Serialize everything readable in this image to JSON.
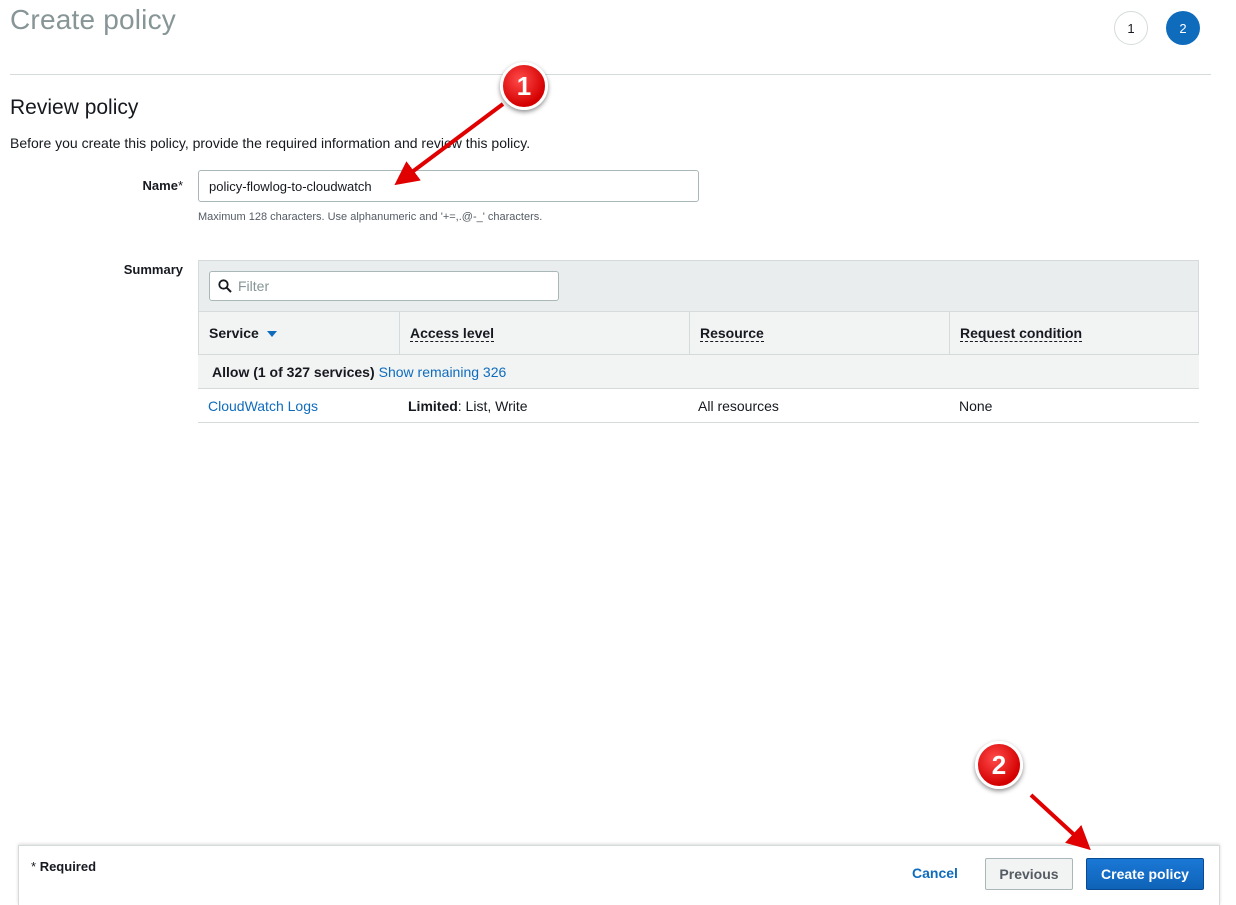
{
  "page": {
    "title": "Create policy",
    "steps": [
      "1",
      "2"
    ],
    "active_step": "2"
  },
  "review": {
    "title": "Review policy",
    "description": "Before you create this policy, provide the required information and review this policy."
  },
  "name_field": {
    "label": "Name",
    "required_mark": "*",
    "value": "policy-flowlog-to-cloudwatch",
    "hint": "Maximum 128 characters. Use alphanumeric and '+=,.@-_' characters."
  },
  "summary": {
    "label": "Summary",
    "filter_placeholder": "Filter",
    "columns": [
      "Service",
      "Access level",
      "Resource",
      "Request condition"
    ],
    "group": {
      "label": "Allow (1 of 327 services)",
      "link": "Show remaining 326"
    },
    "rows": [
      {
        "service": "CloudWatch Logs",
        "access_level_bold": "Limited",
        "access_level_rest": ": List, Write",
        "resource": "All resources",
        "request_condition": "None"
      }
    ]
  },
  "footer": {
    "required_note_mark": "*",
    "required_note": "Required",
    "cancel": "Cancel",
    "previous": "Previous",
    "create": "Create policy"
  },
  "annotations": [
    "1",
    "2"
  ],
  "colors": {
    "primary": "#0f6cbd",
    "callout": "#d40000",
    "title_gray": "#879596"
  }
}
